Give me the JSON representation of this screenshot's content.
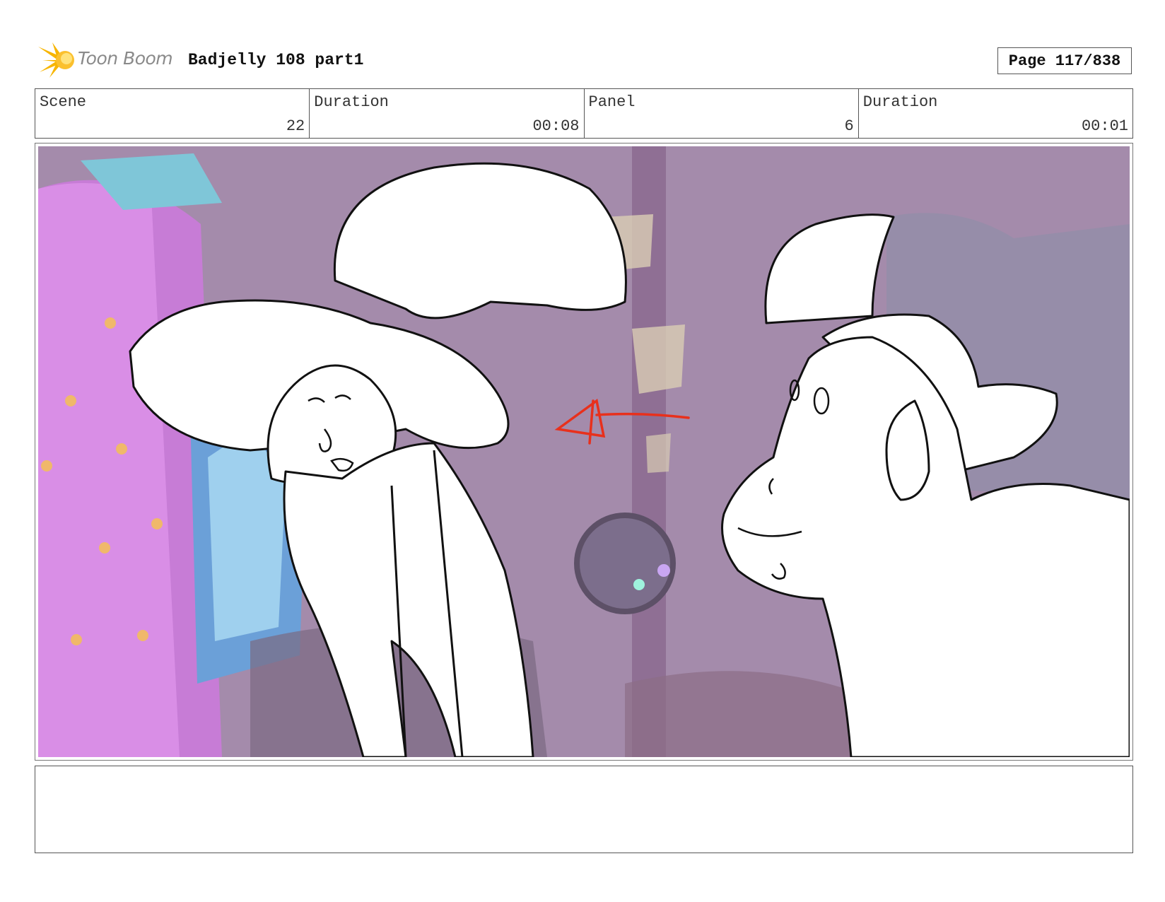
{
  "header": {
    "logo_text": "Toon Boom",
    "project_title": "Badjelly 108 part1",
    "page_label": "Page 117/838"
  },
  "info": {
    "scene_label": "Scene",
    "scene_value": "22",
    "scene_duration_label": "Duration",
    "scene_duration_value": "00:08",
    "panel_label": "Panel",
    "panel_value": "6",
    "panel_duration_label": "Duration",
    "panel_duration_value": "00:01"
  },
  "panel": {
    "background_color": "#9d7fa6",
    "accent_color": "#e8301c",
    "arrow_icon": "red-direction-arrow-icon"
  },
  "notes": {
    "text": ""
  }
}
